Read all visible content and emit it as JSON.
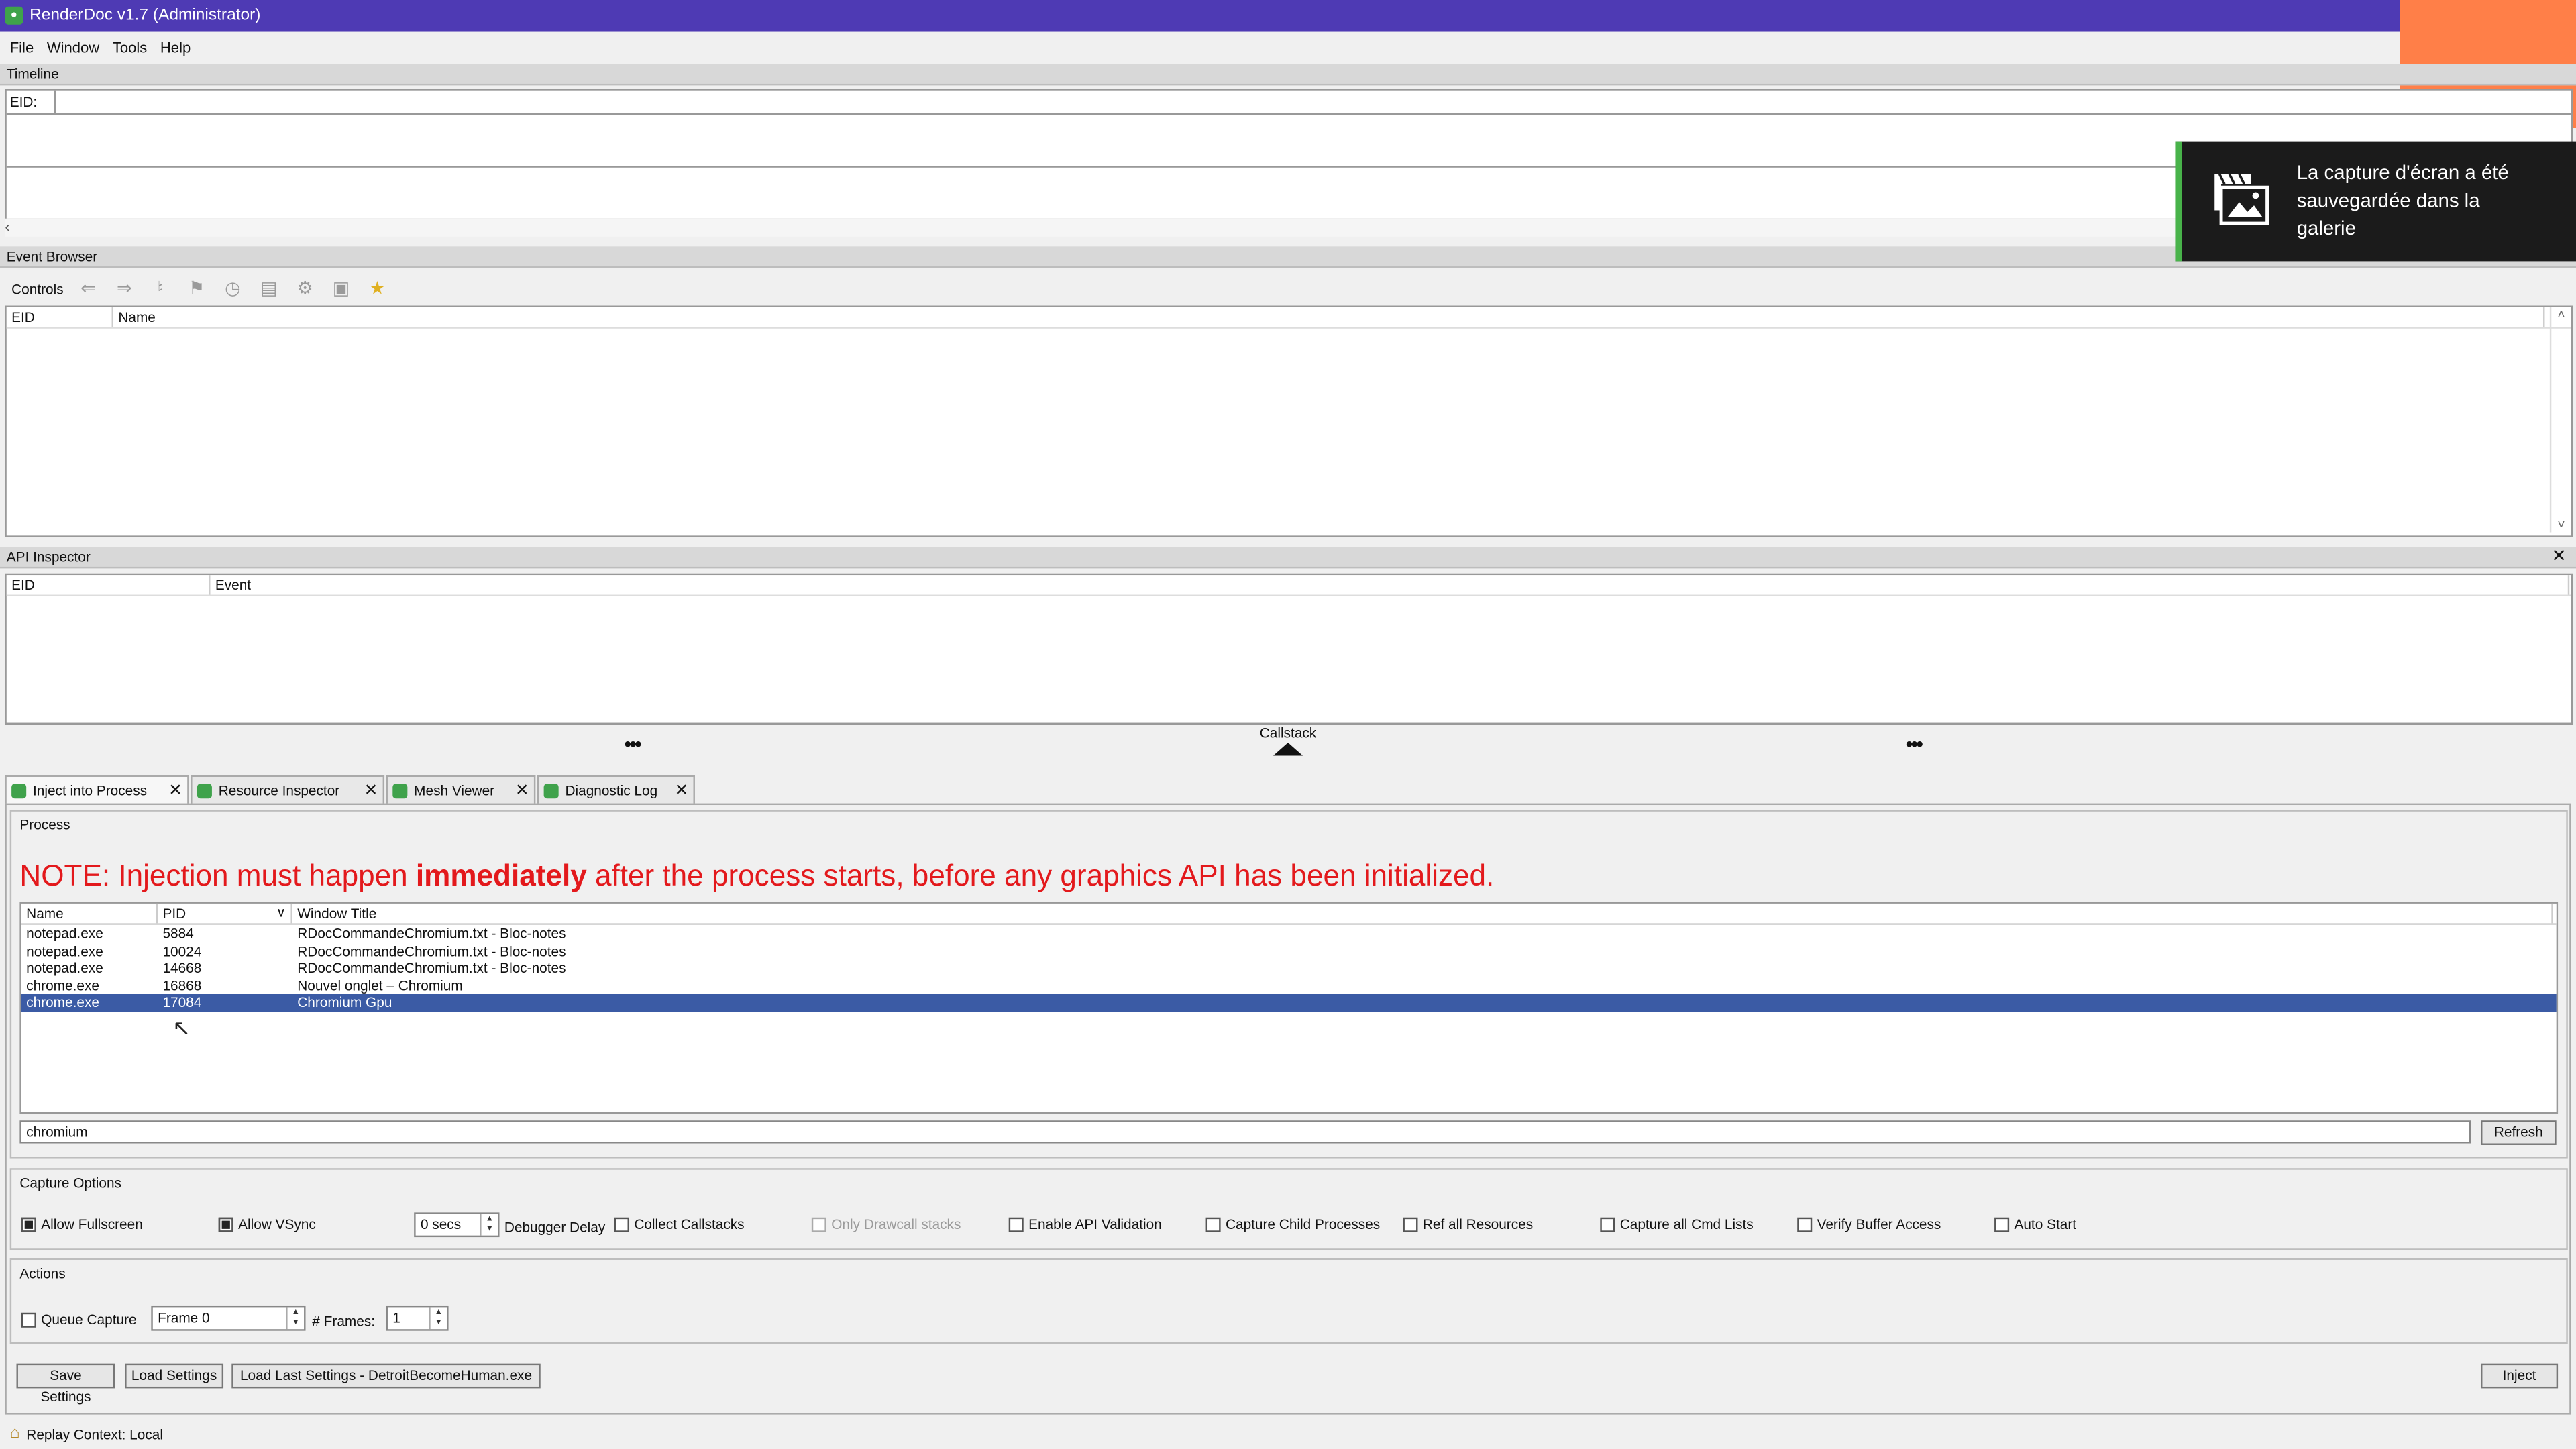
{
  "window": {
    "title": "RenderDoc v1.7 (Administrator)"
  },
  "menu": [
    "File",
    "Window",
    "Tools",
    "Help"
  ],
  "timeline": {
    "header": "Timeline",
    "eid_label": "EID:"
  },
  "event_browser": {
    "header": "Event Browser",
    "controls_label": "Controls",
    "columns": [
      "EID",
      "Name"
    ]
  },
  "api_inspector": {
    "header": "API Inspector",
    "columns": [
      "EID",
      "Event"
    ],
    "callstack_label": "Callstack"
  },
  "tabs": [
    {
      "label": "Inject into Process",
      "active": true
    },
    {
      "label": "Resource Inspector",
      "active": false
    },
    {
      "label": "Mesh Viewer",
      "active": false
    },
    {
      "label": "Diagnostic Log",
      "active": false
    }
  ],
  "process": {
    "group_title": "Process",
    "note_prefix": "NOTE: Injection must happen ",
    "note_bold": "immediately",
    "note_suffix": " after the process starts, before any graphics API has been initialized.",
    "columns": [
      "Name",
      "PID",
      "Window Title"
    ],
    "rows": [
      {
        "name": "notepad.exe",
        "pid": "5884",
        "title": "RDocCommandeChromium.txt - Bloc-notes",
        "selected": false
      },
      {
        "name": "notepad.exe",
        "pid": "10024",
        "title": "RDocCommandeChromium.txt - Bloc-notes",
        "selected": false
      },
      {
        "name": "notepad.exe",
        "pid": "14668",
        "title": "RDocCommandeChromium.txt - Bloc-notes",
        "selected": false
      },
      {
        "name": "chrome.exe",
        "pid": "16868",
        "title": "Nouvel onglet – Chromium",
        "selected": false
      },
      {
        "name": "chrome.exe",
        "pid": "17084",
        "title": "Chromium Gpu",
        "selected": true
      }
    ],
    "filter_value": "chromium",
    "refresh_label": "Refresh"
  },
  "capture_options": {
    "group_title": "Capture Options",
    "allow_fullscreen": {
      "label": "Allow Fullscreen",
      "checked": true
    },
    "allow_vsync": {
      "label": "Allow VSync",
      "checked": true
    },
    "delay_value": "0 secs",
    "debugger_delay_label": "Debugger Delay",
    "collect_callstacks": {
      "label": "Collect Callstacks",
      "checked": false
    },
    "only_drawcall_stacks": {
      "label": "Only Drawcall stacks",
      "checked": false
    },
    "enable_api_validation": {
      "label": "Enable API Validation",
      "checked": false
    },
    "capture_child_processes": {
      "label": "Capture Child Processes",
      "checked": false
    },
    "ref_all_resources": {
      "label": "Ref all Resources",
      "checked": false
    },
    "capture_all_cmd_lists": {
      "label": "Capture all Cmd Lists",
      "checked": false
    },
    "verify_buffer_access": {
      "label": "Verify Buffer Access",
      "checked": false
    },
    "auto_start": {
      "label": "Auto Start",
      "checked": false
    }
  },
  "actions": {
    "group_title": "Actions",
    "queue_capture_label": "Queue Capture",
    "frame_value": "Frame 0",
    "frames_label": "# Frames:",
    "frames_value": "1"
  },
  "buttons": {
    "save_settings": "Save Settings",
    "load_settings": "Load Settings",
    "load_last_settings": "Load Last Settings - DetroitBecomeHuman.exe",
    "inject": "Inject"
  },
  "status": {
    "replay_context": "Replay Context: Local"
  },
  "notification": {
    "text": "La capture d'écran a été sauvegardée dans la galerie"
  },
  "colors": {
    "titlebar": "#4e3ab4",
    "note_red": "#e3191c",
    "selection": "#3b5ba5",
    "orange": "#ff7f48"
  }
}
